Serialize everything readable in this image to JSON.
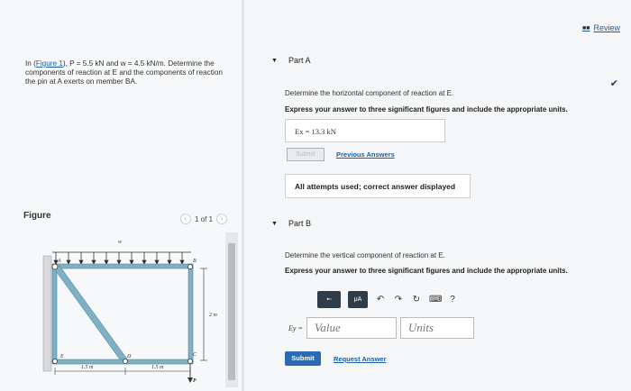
{
  "review": {
    "icon": "list-icon",
    "label": "Review"
  },
  "problem": {
    "p1": "In (",
    "link": "Figure 1",
    "p2": "), P = 5.5 kN and w = 4.5 kN/m. Determine the components of reaction at E and the components of reaction the pin at A exerts on member BA."
  },
  "figure": {
    "label": "Figure",
    "pager": "1 of 1",
    "labels": {
      "A": "A",
      "B": "B",
      "C": "C",
      "D": "D",
      "E": "E",
      "P": "P",
      "w": "w",
      "dim_2m": "2 m",
      "dim_15a": "1.5 m",
      "dim_15b": "1.5 m"
    }
  },
  "partA": {
    "title": "Part A",
    "question": "Determine the horizontal component of reaction at E.",
    "instruction": "Express your answer to three significant figures and include the appropriate units.",
    "answer": "Ex = 13.3 kN",
    "submit_label": "Submit",
    "previous_label": "Previous Answers",
    "note": "All attempts used; correct answer displayed"
  },
  "partB": {
    "title": "Part B",
    "question": "Determine the vertical component of reaction at E.",
    "instruction": "Express your answer to three significant figures and include the appropriate units.",
    "toolbar": {
      "templates": "▪▫",
      "mu": "μA",
      "help": "?"
    },
    "input_label": "Ey =",
    "value_placeholder": "Value",
    "units_placeholder": "Units",
    "submit_label": "Submit",
    "request_label": "Request Answer"
  },
  "colors": {
    "accent": "#2d6bb0",
    "link": "#1a5fa8",
    "frame": "#6fa2b8"
  }
}
